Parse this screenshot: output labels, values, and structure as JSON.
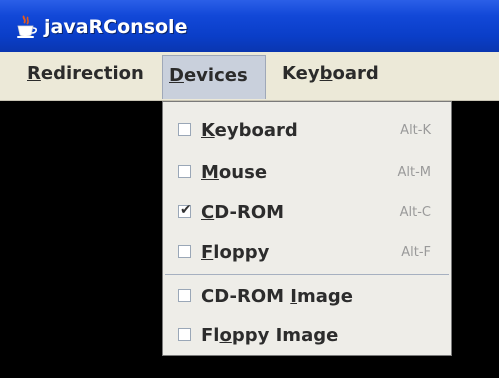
{
  "window": {
    "title": "javaRConsole",
    "icon": "java-cup-icon"
  },
  "menubar": {
    "items": [
      {
        "id": "redirection",
        "label_pre": "",
        "label_u": "R",
        "label_post": "edirection"
      },
      {
        "id": "devices",
        "label_pre": "",
        "label_u": "D",
        "label_post": "evices",
        "active": true
      },
      {
        "id": "keyboard",
        "label_pre": "Key",
        "label_u": "b",
        "label_post": "oard"
      }
    ]
  },
  "devices_menu": {
    "items": [
      {
        "id": "keyboard",
        "label_pre": "",
        "label_u": "K",
        "label_post": "eyboard",
        "accelerator": "Alt-K",
        "checked": false
      },
      {
        "id": "mouse",
        "label_pre": "",
        "label_u": "M",
        "label_post": "ouse",
        "accelerator": "Alt-M",
        "checked": false
      },
      {
        "id": "cdrom",
        "label_pre": "",
        "label_u": "C",
        "label_post": "D-ROM",
        "accelerator": "Alt-C",
        "checked": true
      },
      {
        "id": "floppy",
        "label_pre": "",
        "label_u": "F",
        "label_post": "loppy",
        "accelerator": "Alt-F",
        "checked": false
      },
      {
        "id": "cdrom-image",
        "label_pre": "CD-ROM ",
        "label_u": "I",
        "label_post": "mage",
        "accelerator": "",
        "checked": false
      },
      {
        "id": "floppy-image",
        "label_pre": "Fl",
        "label_u": "o",
        "label_post": "ppy Image",
        "accelerator": "",
        "checked": false
      }
    ]
  },
  "colors": {
    "titlebar": "#0a3ec8",
    "console": "#000000",
    "menu_bg": "#ece9d8"
  }
}
